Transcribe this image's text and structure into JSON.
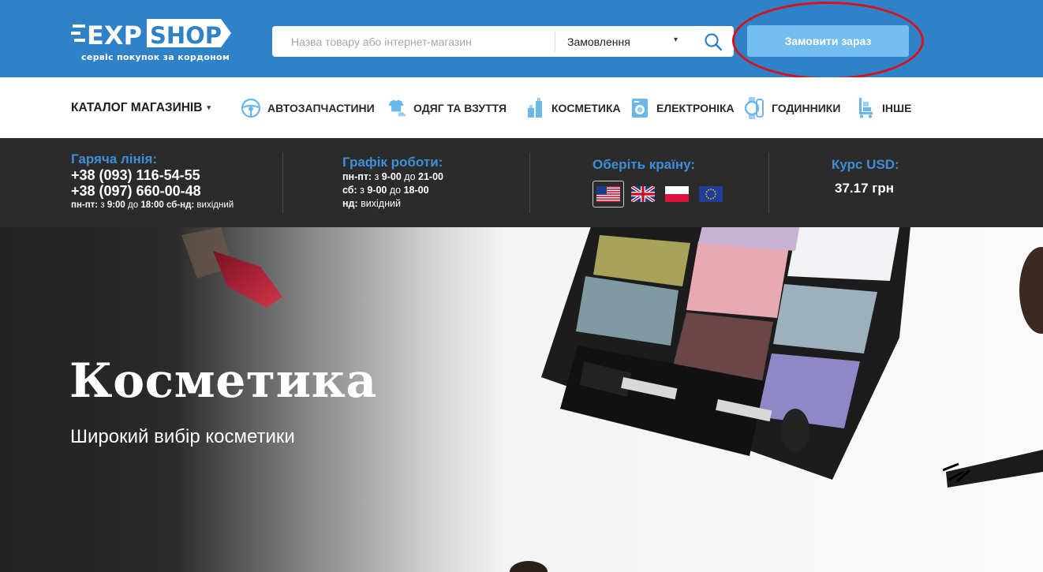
{
  "header": {
    "logo_text_exp": "EXP",
    "logo_text_shop": "SHOP",
    "logo_tagline": "сервіс покупок за кордоном",
    "search_placeholder": "Назва товару або інтернет-магазин",
    "select_value": "Замовлення",
    "order_button": "Замовити зараз",
    "brand_color": "#2f81c8",
    "accent_color": "#74bdef",
    "highlight_color": "#d6121e"
  },
  "nav": {
    "catalog": "КАТАЛОГ МАГАЗИНІВ",
    "items": [
      {
        "label": "АВТОЗАПЧАСТИНИ",
        "icon": "steering-wheel-icon"
      },
      {
        "label": "ОДЯГ ТА ВЗУТТЯ",
        "icon": "clothes-icon"
      },
      {
        "label": "КОСМЕТИКА",
        "icon": "cosmetics-icon"
      },
      {
        "label": "ЕЛЕКТРОНІКА",
        "icon": "washing-machine-icon"
      },
      {
        "label": "ГОДИННИКИ",
        "icon": "watch-icon"
      },
      {
        "label": "ІНШЕ",
        "icon": "cart-icon"
      }
    ]
  },
  "info": {
    "hotline_title": "Гаряча лінія:",
    "phone1": "+38 (093) 116-54-55",
    "phone2": "+38 (097) 660-00-48",
    "hotline_hours": {
      "d1": "пн-пт:",
      "t1": " з ",
      "h1": "9:00",
      "t2": " до ",
      "h2": "18:00",
      "d2": " сб-нд:",
      "t3": " вихідний"
    },
    "schedule_title": "Графік роботи:",
    "schedule": [
      {
        "day": "пн-пт:",
        "from_word": " з ",
        "from": "9-00",
        "to_word": " до ",
        "to": "21-00"
      },
      {
        "day": "сб:",
        "from_word": " з ",
        "from": "9-00",
        "to_word": " до ",
        "to": "18-00"
      },
      {
        "day": "нд:",
        "rest": " вихідний"
      }
    ],
    "country_title": "Оберіть країну:",
    "flags": [
      "usa-flag-icon",
      "uk-flag-icon",
      "poland-flag-icon",
      "eu-flag-icon"
    ],
    "rate_title": "Курс USD:",
    "rate_value": "37.17 грн"
  },
  "hero": {
    "title": "Косметика",
    "subtitle": "Широкий вибір косметики"
  }
}
